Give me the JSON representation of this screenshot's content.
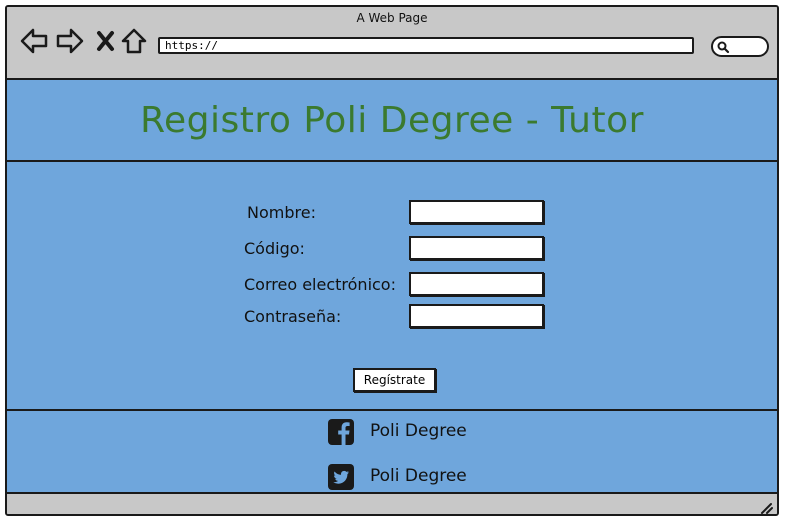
{
  "window": {
    "title": "A Web Page"
  },
  "browser": {
    "url": "https://"
  },
  "page": {
    "title": "Registro Poli Degree - Tutor"
  },
  "form": {
    "fields": [
      {
        "label": "Nombre:",
        "value": ""
      },
      {
        "label": "Código:",
        "value": ""
      },
      {
        "label": "Correo electrónico:",
        "value": ""
      },
      {
        "label": "Contraseña:",
        "value": ""
      }
    ],
    "submit_label": "Regístrate"
  },
  "footer": {
    "links": [
      {
        "icon": "facebook-icon",
        "label": "Poli Degree"
      },
      {
        "icon": "twitter-icon",
        "label": "Poli Degree"
      }
    ]
  },
  "colors": {
    "content_background": "#6fa6dc",
    "title": "#3b7a2f",
    "chrome": "#c8c8c8"
  }
}
